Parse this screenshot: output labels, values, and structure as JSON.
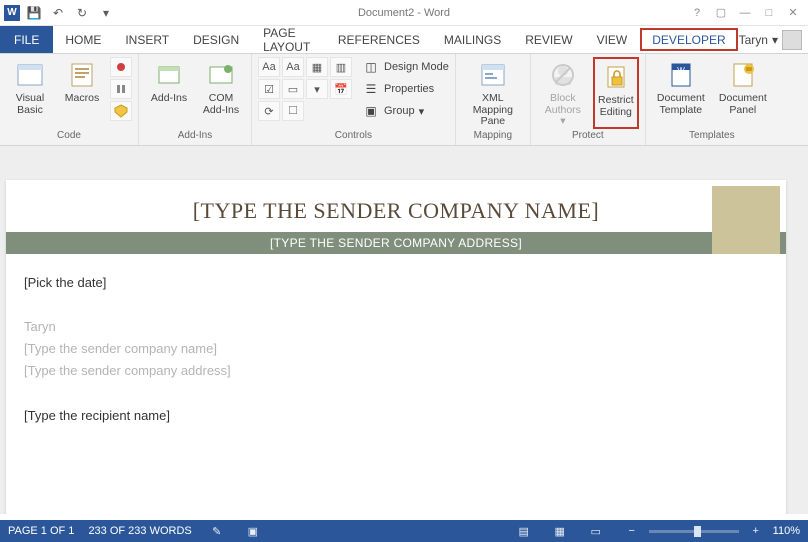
{
  "app": {
    "title": "Document2 - Word"
  },
  "qat": {
    "save": "💾",
    "undo": "↶",
    "redo": "↻",
    "more": "▾"
  },
  "wincontrols": {
    "help": "?",
    "ribbonopts": "▢",
    "min": "—",
    "max": "□",
    "close": "✕"
  },
  "tabs": {
    "file": "FILE",
    "items": [
      "HOME",
      "INSERT",
      "DESIGN",
      "PAGE LAYOUT",
      "REFERENCES",
      "MAILINGS",
      "REVIEW",
      "VIEW",
      "DEVELOPER"
    ],
    "highlight_index": 8,
    "user": "Taryn"
  },
  "ribbon": {
    "groups": {
      "code": {
        "name": "Code",
        "visual_basic": "Visual Basic",
        "macros": "Macros"
      },
      "addins": {
        "name": "Add-Ins",
        "addins": "Add-Ins",
        "com": "COM Add-Ins"
      },
      "controls": {
        "name": "Controls",
        "design_mode": "Design Mode",
        "properties": "Properties",
        "group": "Group"
      },
      "mapping": {
        "name": "Mapping",
        "xml": "XML Mapping Pane"
      },
      "protect": {
        "name": "Protect",
        "block": "Block Authors",
        "restrict": "Restrict Editing"
      },
      "templates": {
        "name": "Templates",
        "doctmpl": "Document Template",
        "docpanel": "Document Panel"
      }
    }
  },
  "document": {
    "header_title": "[TYPE THE SENDER COMPANY NAME]",
    "header_addr": "[TYPE THE SENDER COMPANY ADDRESS]",
    "date_field": "[Pick the date]",
    "sender_name": "Taryn",
    "sender_company": "[Type the sender company name]",
    "sender_address": "[Type the sender company address]",
    "recipient": "[Type the recipient name]"
  },
  "status": {
    "page": "PAGE 1 OF 1",
    "words": "233 OF 233 WORDS",
    "zoom": "110%",
    "zminus": "−",
    "zplus": "+"
  }
}
